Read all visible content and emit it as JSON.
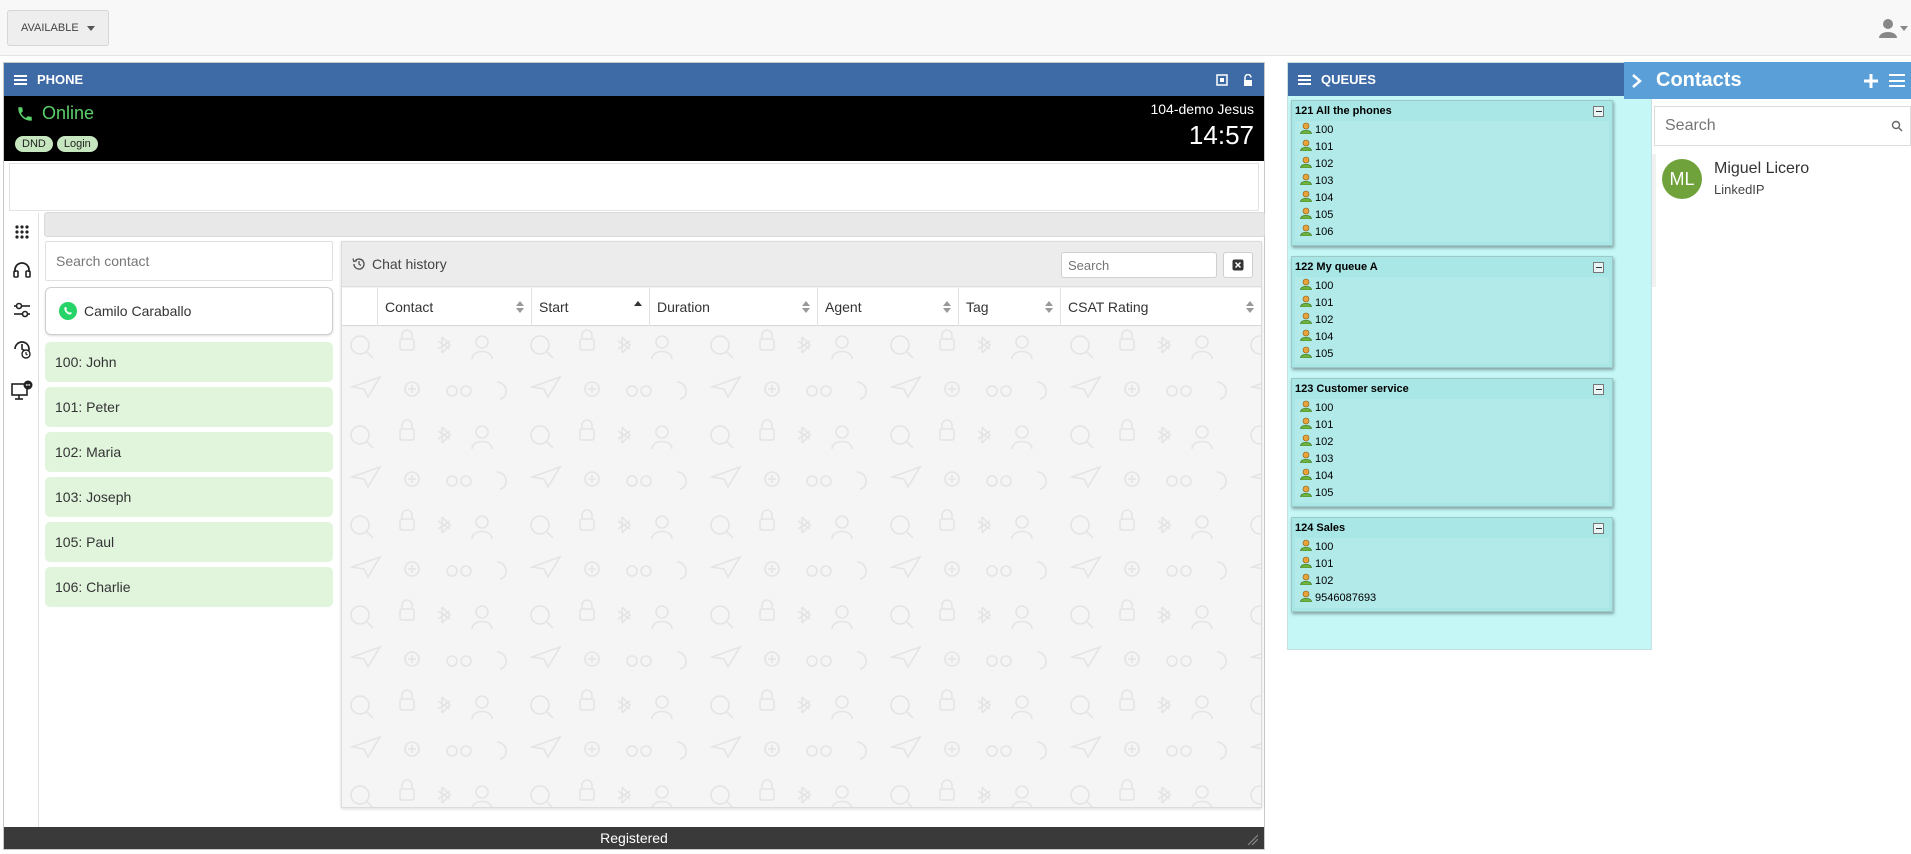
{
  "topbar": {
    "status": "AVAILABLE"
  },
  "phone": {
    "title": "PHONE",
    "state": "Online",
    "badges": [
      "DND",
      "Login"
    ],
    "agent": "104-demo Jesus",
    "time": "14:57",
    "search_placeholder": "Search contact",
    "chat_contact": "Camilo Caraballo",
    "contacts": [
      "100: John",
      "101: Peter",
      "102: Maria",
      "103: Joseph",
      "105: Paul",
      "106: Charlie"
    ],
    "status_bar": "Registered"
  },
  "chat_history": {
    "title": "Chat history",
    "search_placeholder": "Search",
    "columns": [
      "Contact",
      "Start",
      "Duration",
      "Agent",
      "Tag",
      "CSAT Rating"
    ]
  },
  "queues": {
    "title": "QUEUES",
    "list": [
      {
        "name": "121 All the phones",
        "members": [
          "100",
          "101",
          "102",
          "103",
          "104",
          "105",
          "106"
        ]
      },
      {
        "name": "122 My queue A",
        "members": [
          "100",
          "101",
          "102",
          "104",
          "105"
        ]
      },
      {
        "name": "123 Customer service",
        "members": [
          "100",
          "101",
          "102",
          "103",
          "104",
          "105"
        ]
      },
      {
        "name": "124 Sales",
        "members": [
          "100",
          "101",
          "102",
          "9546087693"
        ]
      }
    ]
  },
  "contacts": {
    "title": "Contacts",
    "search_placeholder": "Search",
    "items": [
      {
        "initials": "ML",
        "name": "Miguel Licero",
        "company": "LinkedIP"
      }
    ]
  },
  "colors": {
    "header_blue": "#3e6aa6",
    "contacts_blue": "#5a9fd8",
    "online_green": "#5bd16a",
    "queue_bg": "#c5f7f7",
    "avatar_green": "#6fa23b"
  }
}
